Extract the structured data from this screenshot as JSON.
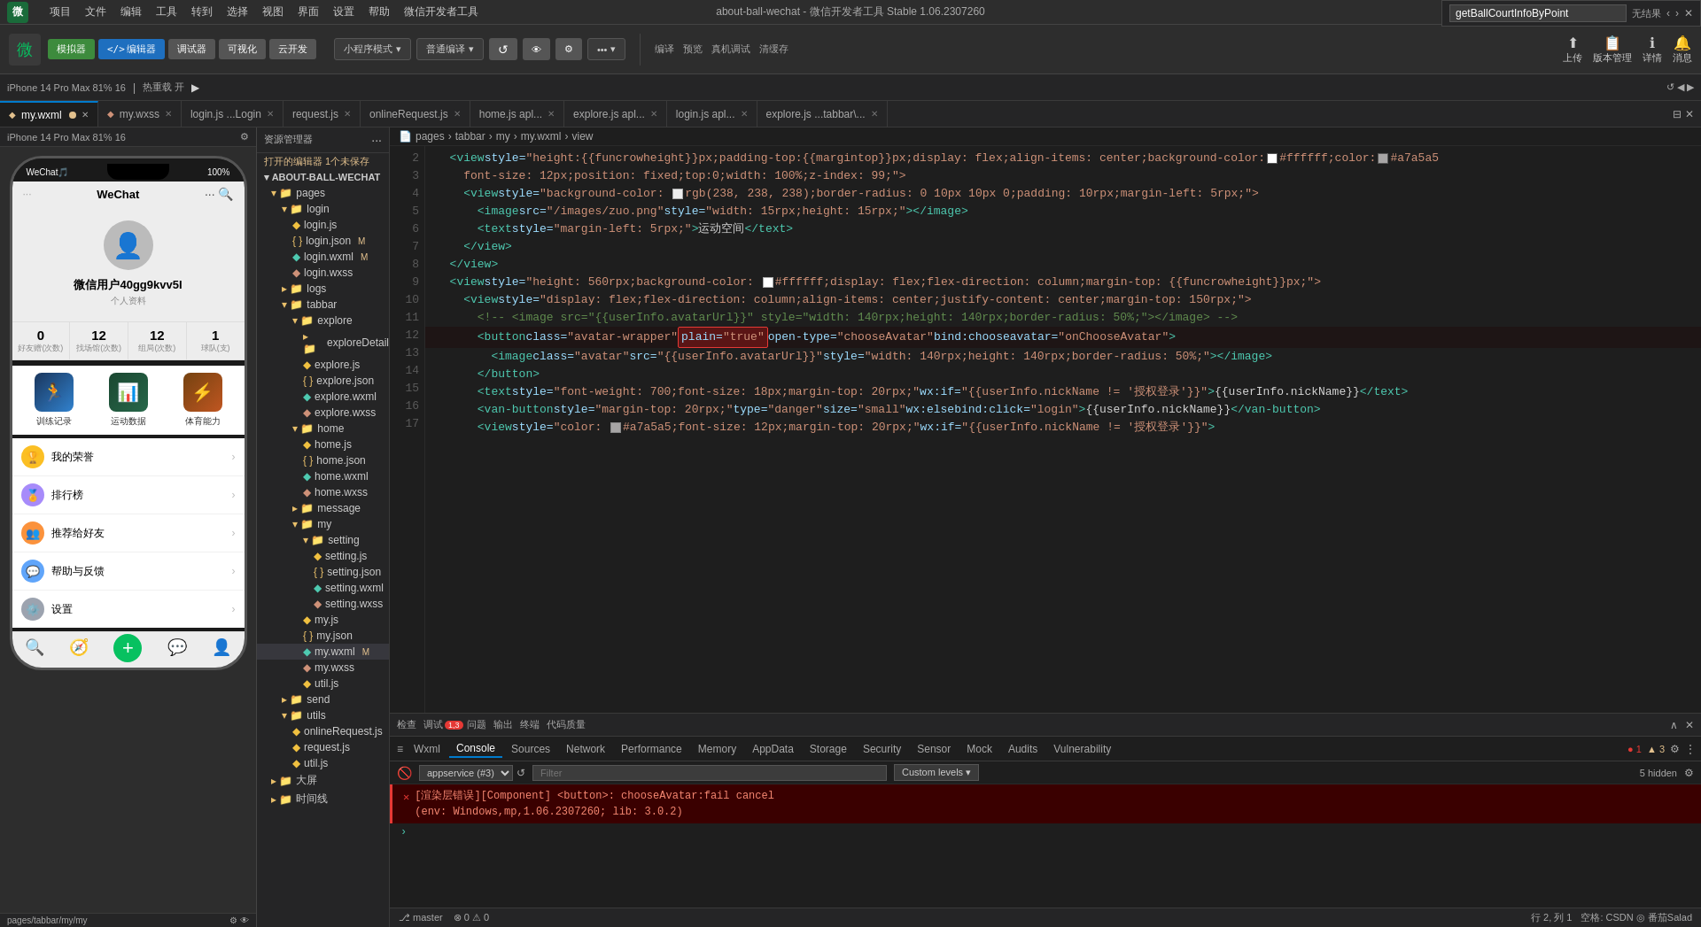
{
  "window": {
    "title": "about-ball-wechat - 微信开发者工具 Stable 1.06.2307260",
    "controls": [
      "minimize",
      "maximize",
      "close"
    ]
  },
  "menu": {
    "items": [
      "项目",
      "文件",
      "编辑",
      "工具",
      "转到",
      "选择",
      "视图",
      "界面",
      "设置",
      "帮助",
      "微信开发者工具"
    ]
  },
  "toolbar": {
    "mode_label": "小程序模式",
    "compiler_label": "普通编译",
    "buttons": [
      "模拟器",
      "编辑器",
      "调试器",
      "可视化",
      "云开发"
    ],
    "right_items": [
      "上传",
      "版本管理",
      "详情",
      "消息"
    ]
  },
  "toolbar2": {
    "device": "iPhone 14 Pro Max 81% 16",
    "hotspot": "热重载 开",
    "page_path": "pages/tabbar/my/my"
  },
  "tabs": [
    {
      "label": "my.wxml",
      "active": true,
      "modified": true,
      "icon": "dot"
    },
    {
      "label": "my.wxss",
      "active": false
    },
    {
      "label": "login.js ...Login",
      "active": false
    },
    {
      "label": "request.js",
      "active": false
    },
    {
      "label": "onlineRequest.js",
      "active": false
    },
    {
      "label": "home.js apl...",
      "active": false
    },
    {
      "label": "explore.js apl...",
      "active": false
    },
    {
      "label": "login.js apl...",
      "active": false
    },
    {
      "label": "explore.js ...tabbar\\...",
      "active": false
    }
  ],
  "breadcrumb": {
    "path": "pages > tabbar > my > my.wxml > view"
  },
  "file_explorer": {
    "title": "资源管理器",
    "project": "打开的编辑器 1个未保存",
    "root": "ABOUT-BALL-WECHAT",
    "tree": [
      {
        "name": "pages",
        "type": "folder",
        "level": 1,
        "expanded": true
      },
      {
        "name": "login",
        "type": "folder",
        "level": 2,
        "expanded": true
      },
      {
        "name": "login.js",
        "type": "js",
        "level": 3
      },
      {
        "name": "login.json",
        "type": "json",
        "level": 3,
        "tag": "M"
      },
      {
        "name": "login.wxml",
        "type": "wxml",
        "level": 3,
        "tag": "M"
      },
      {
        "name": "login.wxss",
        "type": "wxss",
        "level": 3
      },
      {
        "name": "logs",
        "type": "folder",
        "level": 2
      },
      {
        "name": "tabbar",
        "type": "folder",
        "level": 2,
        "expanded": true
      },
      {
        "name": "explore",
        "type": "folder",
        "level": 3,
        "expanded": true
      },
      {
        "name": "exploreDetail",
        "type": "folder",
        "level": 4
      },
      {
        "name": "explore.js",
        "type": "js",
        "level": 4
      },
      {
        "name": "explore.json",
        "type": "json",
        "level": 4
      },
      {
        "name": "explore.wxml",
        "type": "wxml",
        "level": 4
      },
      {
        "name": "explore.wxss",
        "type": "wxss",
        "level": 4
      },
      {
        "name": "home",
        "type": "folder",
        "level": 3,
        "expanded": true
      },
      {
        "name": "home.js",
        "type": "js",
        "level": 4
      },
      {
        "name": "home.json",
        "type": "json",
        "level": 4
      },
      {
        "name": "home.wxml",
        "type": "wxml",
        "level": 4
      },
      {
        "name": "home.wxss",
        "type": "wxss",
        "level": 4
      },
      {
        "name": "message",
        "type": "folder",
        "level": 3
      },
      {
        "name": "my",
        "type": "folder",
        "level": 3,
        "expanded": true
      },
      {
        "name": "setting",
        "type": "folder",
        "level": 4,
        "expanded": true
      },
      {
        "name": "setting.js",
        "type": "js",
        "level": 5
      },
      {
        "name": "setting.json",
        "type": "json",
        "level": 5
      },
      {
        "name": "setting.wxml",
        "type": "wxml",
        "level": 5
      },
      {
        "name": "setting.wxss",
        "type": "wxss",
        "level": 5
      },
      {
        "name": "my.js",
        "type": "js",
        "level": 4
      },
      {
        "name": "my.json",
        "type": "json",
        "level": 4
      },
      {
        "name": "my.wxml",
        "type": "wxml",
        "level": 4,
        "tag": "M",
        "active": true
      },
      {
        "name": "my.wxss",
        "type": "wxss",
        "level": 4
      },
      {
        "name": "util.js",
        "type": "js",
        "level": 4
      },
      {
        "name": "send",
        "type": "folder",
        "level": 2
      },
      {
        "name": "utils",
        "type": "folder",
        "level": 2,
        "expanded": true
      },
      {
        "name": "onlineRequest.js",
        "type": "js",
        "level": 3
      },
      {
        "name": "request.js",
        "type": "js",
        "level": 3
      },
      {
        "name": "util.js",
        "type": "js",
        "level": 3
      },
      {
        "name": "大屏",
        "type": "folder",
        "level": 1
      },
      {
        "name": "时间线",
        "type": "folder",
        "level": 1
      }
    ]
  },
  "code_editor": {
    "search": {
      "query": "getBallCourtInfoByPoint",
      "result": "无结果"
    },
    "lines": [
      {
        "num": 2,
        "content": "  <view style=\"height:{{funcrowheight}}px;padding-top:{{margintop}}px;display: flex;align-items: center;background-color:",
        "tokens": [
          {
            "t": "tag",
            "v": "<view"
          },
          {
            "t": "attr",
            "v": " style="
          },
          {
            "t": "val",
            "v": "\"height:{{funcrowheight}}px;padding-top:{{margintop}}px;display: flex;align-items: center;background-color:"
          }
        ]
      },
      {
        "num": 3,
        "content": "    font-size: 12px;position: fixed;top:0;width: 100%;z-index: 99;\">"
      },
      {
        "num": 4,
        "content": "    <view style=\"background-color: rgb(238, 238, 238);border-radius: 0 10px 10px 0;padding: 10rpx;margin-left: 5rpx;\">"
      },
      {
        "num": 5,
        "content": "      <image src=\"/images/zuo.png\" style=\"width: 15rpx;height: 15rpx;\"></image>"
      },
      {
        "num": 6,
        "content": "      <text style=\"margin-left: 5rpx;\">运动空间</text>"
      },
      {
        "num": 7,
        "content": "    </view>"
      },
      {
        "num": 8,
        "content": "  </view>"
      },
      {
        "num": 9,
        "content": "  <view style=\"height: 560rpx;background-color: #ffffff;display: flex;flex-direction: column;margin-top: {{funcrowheight}}px;\">"
      },
      {
        "num": 10,
        "content": "    <view style=\"display: flex;flex-direction: column;align-items: center;justify-content: center;margin-top: 150rpx;\">"
      },
      {
        "num": 11,
        "content": "      <!-- <image src=\"{{userInfo.avatarUrl}}\" style=\"width: 140rpx;height: 140rpx;border-radius: 50%;\"></image> -->"
      },
      {
        "num": 12,
        "content": "      <button class=\"avatar-wrapper\" plain=\"true\" open-type=\"chooseAvatar\" bind:chooseavatar=\"onChooseAvatar\">",
        "highlight": true
      },
      {
        "num": 13,
        "content": "        <image class=\"avatar\" src=\"{{userInfo.avatarUrl}}\" style=\"width: 140rpx;height: 140rpx;border-radius: 50%;\"></image>"
      },
      {
        "num": 14,
        "content": "      </button>"
      },
      {
        "num": 15,
        "content": "      <text style=\"font-weight: 700;font-size: 18px;margin-top: 20rpx;\" wx:if=\"{{userInfo.nickName != '授权登录'}}\">{{userInfo.nickName}}</text>"
      },
      {
        "num": 16,
        "content": "      <van-button style=\"margin-top: 20rpx;\" type=\"danger\" size=\"small\" wx:else bind:click=\"login\">{{userInfo.nickName}}</van-button>"
      },
      {
        "num": 17,
        "content": "      <view style=\"color: #a7a5a5;font-size: 12px;margin-top: 20rpx;\" wx:if=\"{{userInfo.nickName != '授权登录'}}\">"
      }
    ]
  },
  "phone": {
    "status_left": "WeChat🎵",
    "battery": "100%",
    "username": "微信用户40gg9kvv5I",
    "profile_link": "个人资料",
    "stats": [
      {
        "num": "0",
        "label": "好友赠(次数)"
      },
      {
        "num": "12",
        "label": "找场馆(次数)"
      },
      {
        "num": "12",
        "label": "组局(次数)"
      },
      {
        "num": "1",
        "label": "球队(支)"
      }
    ],
    "features": [
      {
        "name": "训练记录"
      },
      {
        "name": "运动数据"
      },
      {
        "name": "体育能力"
      }
    ],
    "menu_items": [
      {
        "icon": "🏆",
        "color": "#f59e0b",
        "text": "我的荣誉"
      },
      {
        "icon": "🏅",
        "color": "#8b5cf6",
        "text": "排行榜"
      },
      {
        "icon": "👥",
        "color": "#f97316",
        "text": "推荐给好友"
      },
      {
        "icon": "💬",
        "color": "#3b82f6",
        "text": "帮助与反馈"
      },
      {
        "icon": "⚙️",
        "color": "#6b7280",
        "text": "设置"
      }
    ],
    "bottom_tabs": [
      "🔍",
      "🧭",
      "+",
      "💬",
      "👤"
    ]
  },
  "devtools": {
    "tabs": [
      "检查",
      "调试 1,3",
      "问题",
      "输出",
      "终端",
      "代码质量"
    ],
    "console_tabs": [
      "Wxml",
      "Console",
      "Sources",
      "Network",
      "Performance",
      "Memory",
      "AppData",
      "Storage",
      "Security",
      "Sensor",
      "Mock",
      "Audits",
      "Vulnerability"
    ],
    "appservice": "#3",
    "filter_placeholder": "Filter",
    "custom_levels": "Custom levels ▾",
    "hidden_count": "5 hidden",
    "error": {
      "type": "[渲染层错误]",
      "message": "[Component] <button>: chooseAvatar:fail cancel",
      "detail": "(env: Windows,mp,1.06.2307260; lib: 3.0.2)"
    },
    "badges": {
      "debug": "1,3",
      "errors": "1",
      "warnings": "3"
    }
  },
  "status_bar": {
    "branch": "master",
    "errors": "0",
    "warnings": "0",
    "row_col": "行 2, 列 1",
    "encoding": "空格: CSDN ◎ 番茄Salad"
  }
}
